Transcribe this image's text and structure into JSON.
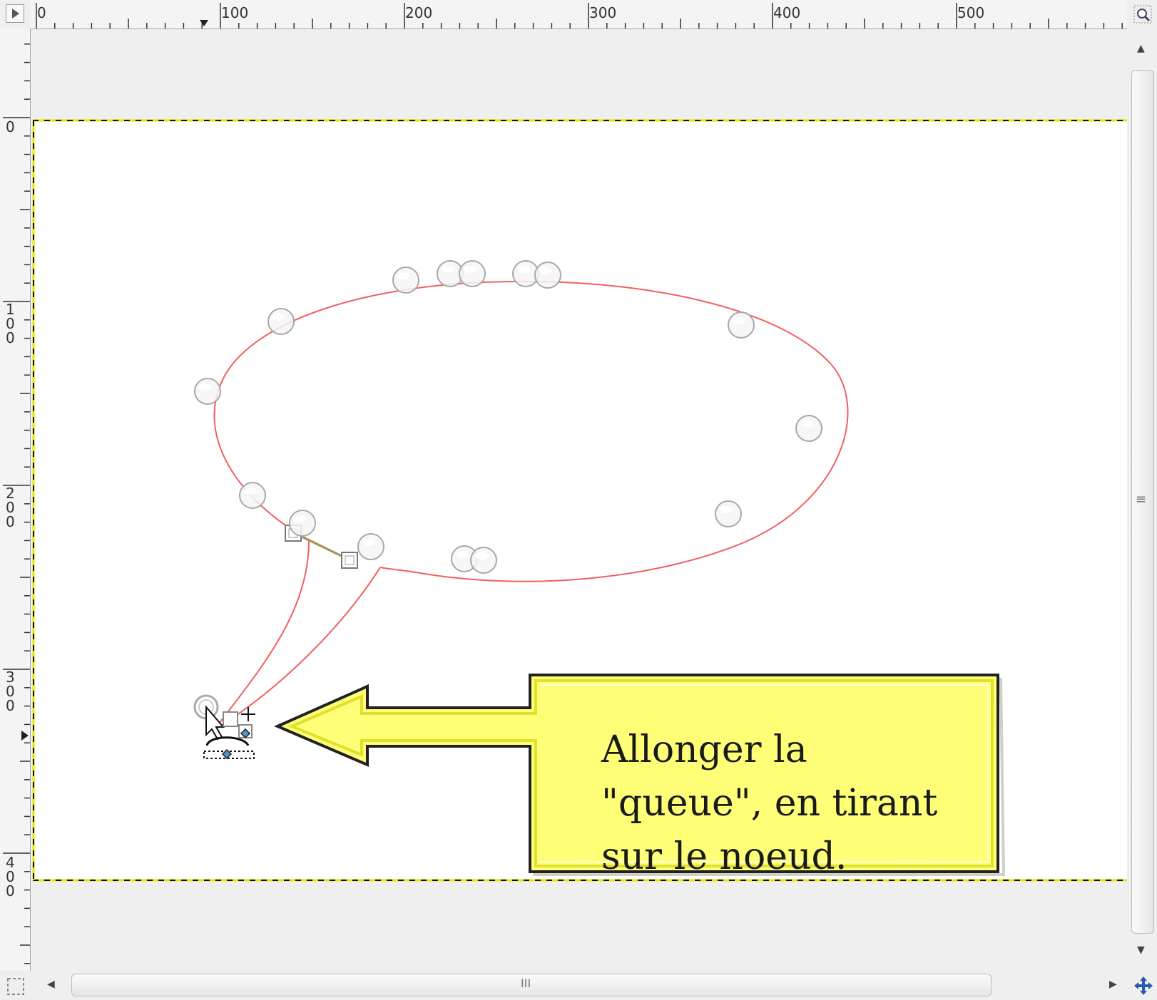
{
  "rulers": {
    "top_labels": [
      "0",
      "100",
      "200",
      "300",
      "400",
      "500"
    ],
    "left_labels": [
      "0",
      "100",
      "200",
      "300",
      "400"
    ]
  },
  "callout": {
    "text": "Allonger la\n\"queue\", en tirant\nsur le noeud.",
    "fill_color": "#ffff77",
    "border_color": "#222222"
  },
  "colors": {
    "path_stroke": "#f06060",
    "canvas": "#ffffff",
    "guide": "#e6e600",
    "background": "#efefef"
  },
  "icons": {
    "ruler_toggle": "triangle-right-icon",
    "zoom_corner": "zoom-icon",
    "nav_corner": "navigate-icon",
    "quick_mask": "quick-mask-icon"
  },
  "scrollbars": {
    "vertical_grip": "≡",
    "horizontal_grip": "III"
  }
}
